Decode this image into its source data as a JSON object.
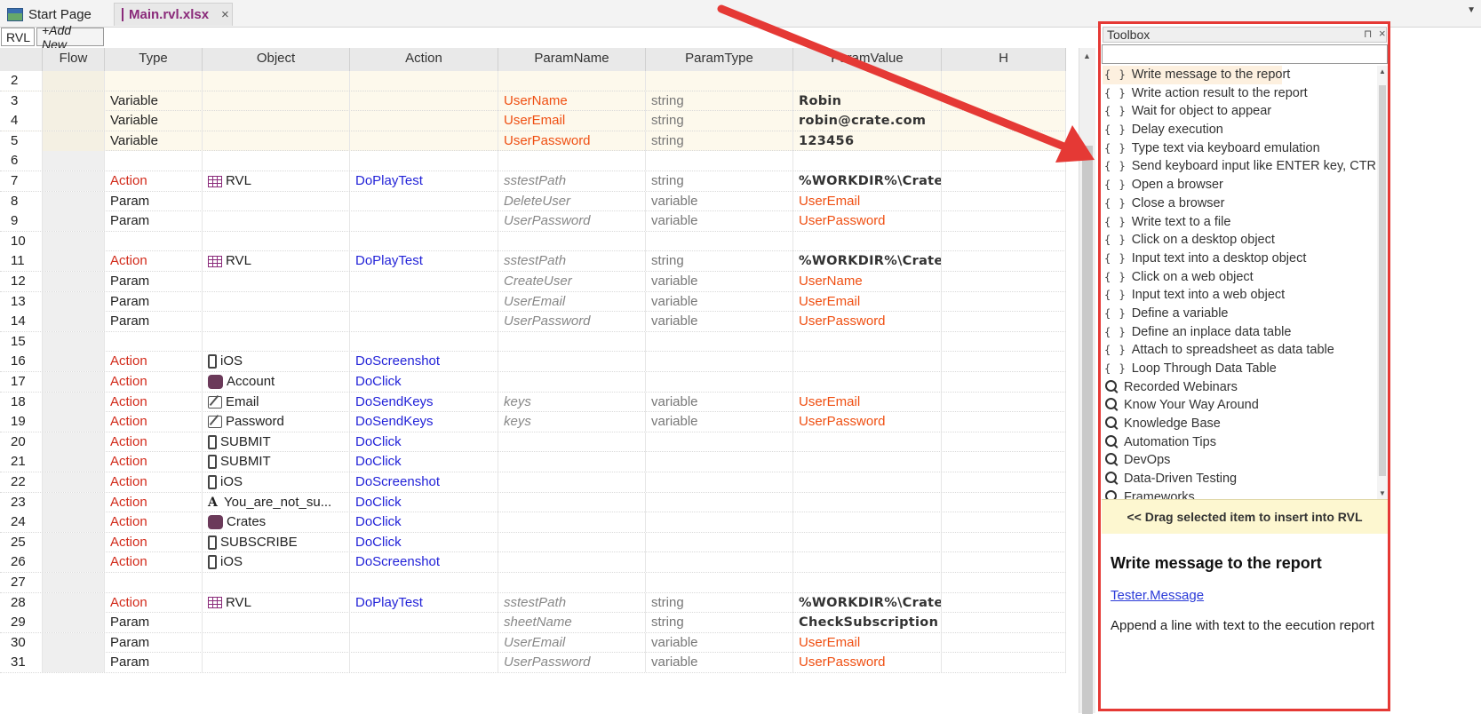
{
  "tabs": {
    "start_page": "Start Page",
    "main_file": "Main.rvl.xlsx",
    "close": "×"
  },
  "sheet_tabs": {
    "rvl": "RVL",
    "add_new": "+Add New"
  },
  "columns": [
    "Flow",
    "Type",
    "Object",
    "Action",
    "ParamName",
    "ParamType",
    "ParamValue",
    "H"
  ],
  "rows": [
    {
      "n": "2"
    },
    {
      "n": "3",
      "type": "Variable",
      "pname": "UserName",
      "ptype": "string",
      "pvalue": "Robin"
    },
    {
      "n": "4",
      "type": "Variable",
      "pname": "UserEmail",
      "ptype": "string",
      "pvalue": "robin@crate.com"
    },
    {
      "n": "5",
      "type": "Variable",
      "pname": "UserPassword",
      "ptype": "string",
      "pvalue": "123456"
    },
    {
      "n": "6"
    },
    {
      "n": "7",
      "type": "Action",
      "object": "RVL",
      "action": "DoPlayTest",
      "pname": "sstestPath",
      "ptype": "string",
      "pvalue": "%WORKDIR%\\CrateApi\\CrateApi..."
    },
    {
      "n": "8",
      "type": "Param",
      "pname": "DeleteUser",
      "ptype": "variable",
      "pvalue": "UserEmail"
    },
    {
      "n": "9",
      "type": "Param",
      "pname": "UserPassword",
      "ptype": "variable",
      "pvalue": "UserPassword"
    },
    {
      "n": "10"
    },
    {
      "n": "11",
      "type": "Action",
      "object": "RVL",
      "action": "DoPlayTest",
      "pname": "sstestPath",
      "ptype": "string",
      "pvalue": "%WORKDIR%\\CrateApi\\CrateApi..."
    },
    {
      "n": "12",
      "type": "Param",
      "pname": "CreateUser",
      "ptype": "variable",
      "pvalue": "UserName"
    },
    {
      "n": "13",
      "type": "Param",
      "pname": "UserEmail",
      "ptype": "variable",
      "pvalue": "UserEmail"
    },
    {
      "n": "14",
      "type": "Param",
      "pname": "UserPassword",
      "ptype": "variable",
      "pvalue": "UserPassword"
    },
    {
      "n": "15"
    },
    {
      "n": "16",
      "type": "Action",
      "object": "iOS",
      "action": "DoScreenshot"
    },
    {
      "n": "17",
      "type": "Action",
      "object": "Account",
      "action": "DoClick"
    },
    {
      "n": "18",
      "type": "Action",
      "object": "Email",
      "action": "DoSendKeys",
      "pname": "keys",
      "ptype": "variable",
      "pvalue": "UserEmail"
    },
    {
      "n": "19",
      "type": "Action",
      "object": "Password",
      "action": "DoSendKeys",
      "pname": "keys",
      "ptype": "variable",
      "pvalue": "UserPassword"
    },
    {
      "n": "20",
      "type": "Action",
      "object": "SUBMIT",
      "action": "DoClick"
    },
    {
      "n": "21",
      "type": "Action",
      "object": "SUBMIT",
      "action": "DoClick"
    },
    {
      "n": "22",
      "type": "Action",
      "object": "iOS",
      "action": "DoScreenshot"
    },
    {
      "n": "23",
      "type": "Action",
      "object": "You_are_not_su...",
      "action": "DoClick"
    },
    {
      "n": "24",
      "type": "Action",
      "object": "Crates",
      "action": "DoClick"
    },
    {
      "n": "25",
      "type": "Action",
      "object": "SUBSCRIBE",
      "action": "DoClick"
    },
    {
      "n": "26",
      "type": "Action",
      "object": "iOS",
      "action": "DoScreenshot"
    },
    {
      "n": "27"
    },
    {
      "n": "28",
      "type": "Action",
      "object": "RVL",
      "action": "DoPlayTest",
      "pname": "sstestPath",
      "ptype": "string",
      "pvalue": "%WORKDIR%\\CrateWeb\\CrateWeb.s"
    },
    {
      "n": "29",
      "type": "Param",
      "pname": "sheetName",
      "ptype": "string",
      "pvalue": "CheckSubscription"
    },
    {
      "n": "30",
      "type": "Param",
      "pname": "UserEmail",
      "ptype": "variable",
      "pvalue": "UserEmail"
    },
    {
      "n": "31",
      "type": "Param",
      "pname": "UserPassword",
      "ptype": "variable",
      "pvalue": "UserPassword"
    }
  ],
  "object_icons": {
    "RVL": "table-icon",
    "iOS": "phone-icon",
    "Account": "app-icon",
    "Email": "edit-icon",
    "Password": "edit-icon",
    "SUBMIT": "phone-icon",
    "You_are_not_su...": "text-icon",
    "Crates": "app-icon",
    "SUBSCRIBE": "phone-icon"
  },
  "toolbox": {
    "title": "Toolbox",
    "pin": "⊓",
    "close": "×",
    "search_value": "",
    "items": [
      {
        "label": "Write message to the report",
        "kind": "brace"
      },
      {
        "label": "Write action result to the report",
        "kind": "brace"
      },
      {
        "label": "Wait for object to appear",
        "kind": "brace"
      },
      {
        "label": "Delay execution",
        "kind": "brace"
      },
      {
        "label": "Type text via keyboard emulation",
        "kind": "brace"
      },
      {
        "label": "Send keyboard input like ENTER key, CTRL",
        "kind": "brace"
      },
      {
        "label": "Open a browser",
        "kind": "brace"
      },
      {
        "label": "Close a browser",
        "kind": "brace"
      },
      {
        "label": "Write text to a file",
        "kind": "brace"
      },
      {
        "label": "Click on a desktop object",
        "kind": "brace"
      },
      {
        "label": "Input text into a desktop object",
        "kind": "brace"
      },
      {
        "label": "Click on a web object",
        "kind": "brace"
      },
      {
        "label": "Input text into a web object",
        "kind": "brace"
      },
      {
        "label": "Define a variable",
        "kind": "brace"
      },
      {
        "label": "Define an inplace data table",
        "kind": "brace"
      },
      {
        "label": "Attach to spreadsheet as data table",
        "kind": "brace"
      },
      {
        "label": "Loop Through Data Table",
        "kind": "brace"
      },
      {
        "label": "Recorded Webinars",
        "kind": "search"
      },
      {
        "label": "Know Your Way Around",
        "kind": "search"
      },
      {
        "label": "Knowledge Base",
        "kind": "search"
      },
      {
        "label": "Automation Tips",
        "kind": "search"
      },
      {
        "label": "DevOps",
        "kind": "search"
      },
      {
        "label": "Data-Driven Testing",
        "kind": "search"
      },
      {
        "label": "Frameworks",
        "kind": "search"
      }
    ],
    "brace_glyph": "{ }",
    "drag_hint": "<< Drag selected item to insert into RVL",
    "desc_title": "Write message to the report",
    "desc_link": "Tester.Message",
    "desc_text": "Append a line with text to the eecution report"
  },
  "colors": {
    "type_action": "#d22a1a",
    "action_blue": "#2323d8",
    "variable_orange": "#ef4f12",
    "highlight_frame": "#e53935"
  }
}
